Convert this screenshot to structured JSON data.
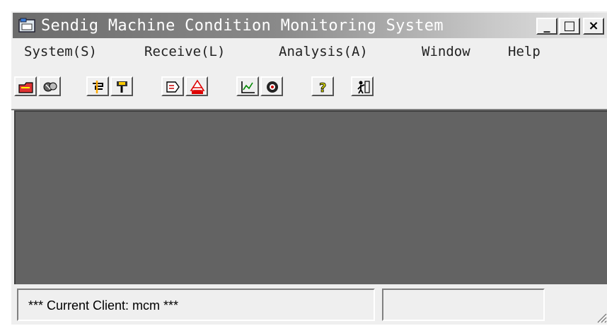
{
  "window": {
    "title": "Sendig Machine Condition Monitoring System",
    "minimize_label": "_",
    "maximize_label": "□",
    "close_label": "×"
  },
  "menu": [
    {
      "label": "System(S)"
    },
    {
      "label": "Receive(L)"
    },
    {
      "label": "Analysis(A)"
    },
    {
      "label": "Window"
    },
    {
      "label": "Help"
    }
  ],
  "toolbar": {
    "icons": [
      "open-folder-icon",
      "network-icon",
      "receive-icon",
      "download-icon",
      "export-icon",
      "start-icon",
      "chart-icon",
      "view-icon",
      "help-icon",
      "exit-icon"
    ]
  },
  "status": {
    "client_text": "*** Current Client: mcm ***",
    "second_pane": ""
  },
  "colors": {
    "client_area": "#636363",
    "chrome": "#efefef",
    "title_gradient_start": "#6c6c6c"
  }
}
